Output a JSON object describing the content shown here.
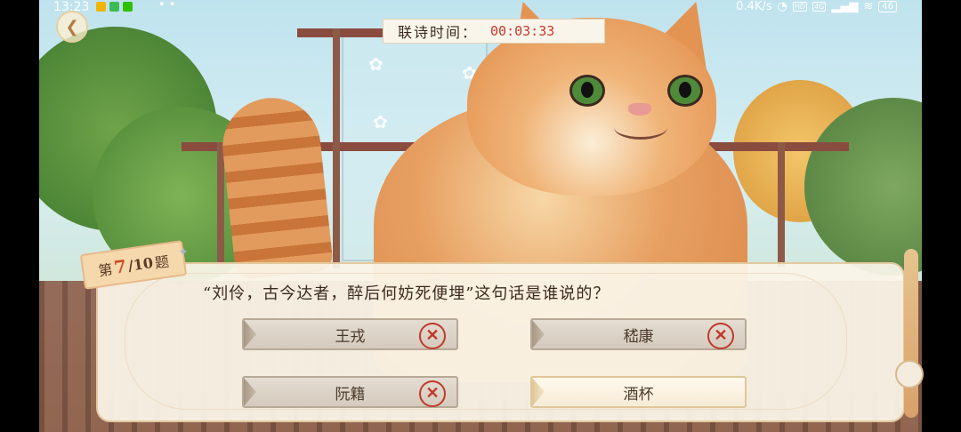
{
  "status_bar": {
    "time": "13:23",
    "more": "• •",
    "network_speed": "0.4K/s",
    "hd_badge": "HD",
    "signal_badge": "4G",
    "battery": "46"
  },
  "timer": {
    "label": "联诗时间：",
    "value": "00:03:33"
  },
  "question_tag": {
    "prefix": "第",
    "number": "7",
    "total": "/10",
    "suffix": "题"
  },
  "question": {
    "text": "“刘伶，古今达者，醉后何妨死便埋”这句话是谁说的？"
  },
  "options": [
    {
      "label": "王戎",
      "wrong": true
    },
    {
      "label": "嵇康",
      "wrong": true
    },
    {
      "label": "阮籍",
      "wrong": true
    },
    {
      "label": "酒杯",
      "wrong": false
    }
  ],
  "icons": {
    "back": "back-arrow-icon",
    "wrong": "cross-circle-icon",
    "paw": "paw-print-icon"
  },
  "colors": {
    "timer_value": "#c0392b",
    "question_number": "#d24b2a",
    "wrong_mark": "#c0392b"
  }
}
